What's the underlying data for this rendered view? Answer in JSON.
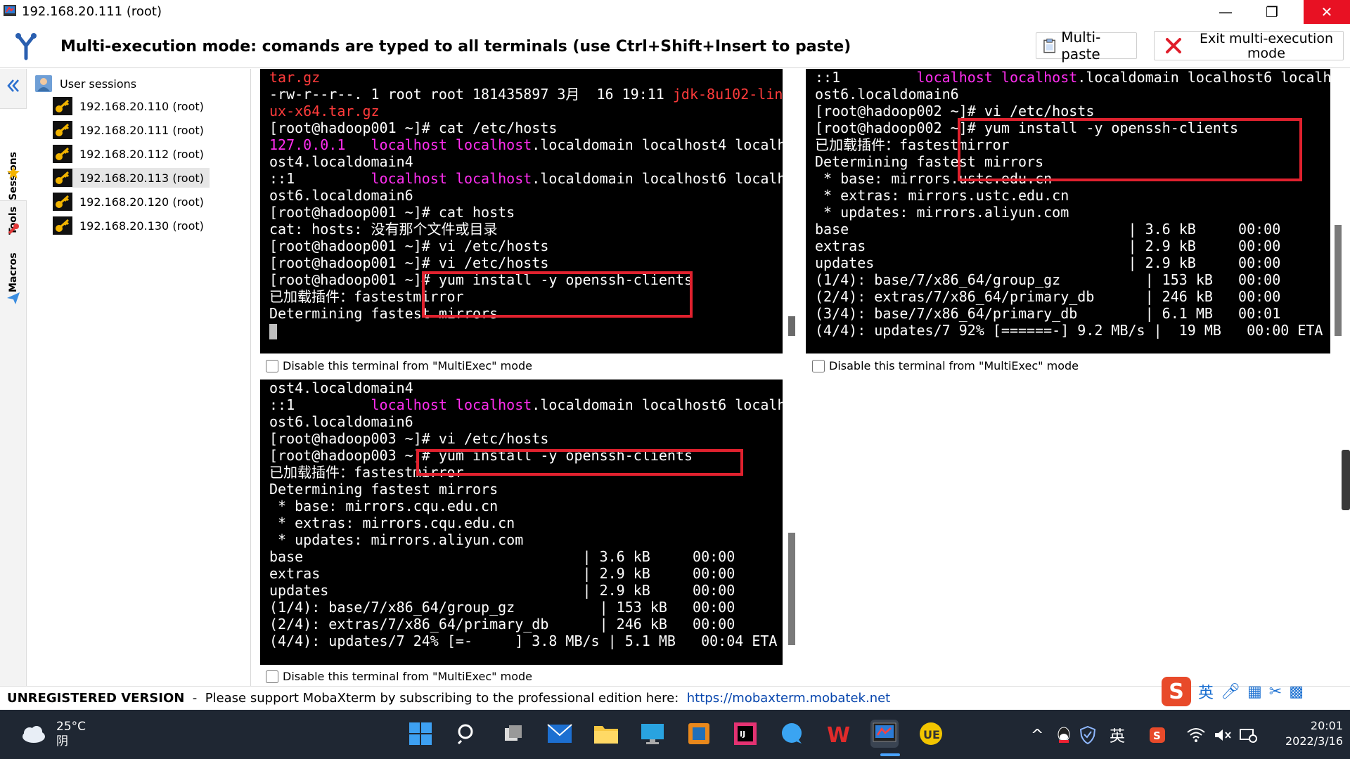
{
  "window": {
    "title": "192.168.20.111 (root)",
    "minimize": "—",
    "maximize": "❐",
    "close": "✕"
  },
  "toolbar": {
    "mode_text": "Multi-execution mode: comands are typed to all terminals (use Ctrl+Shift+Insert to paste)",
    "multipaste_label": "Multi-paste",
    "exit_label": "Exit multi-execution mode"
  },
  "sidebar": {
    "tabs": [
      "Sessions",
      "Tools",
      "Macros"
    ]
  },
  "sessions": {
    "root_label": "User sessions",
    "items": [
      {
        "label": "192.168.20.110 (root)"
      },
      {
        "label": "192.168.20.111 (root)"
      },
      {
        "label": "192.168.20.112 (root)"
      },
      {
        "label": "192.168.20.113 (root)"
      },
      {
        "label": "192.168.20.120 (root)"
      },
      {
        "label": "192.168.20.130 (root)"
      }
    ],
    "selected_index": 3
  },
  "terminals": [
    {
      "name": "hadoop001",
      "lines": [
        [
          {
            "t": "tar.gz",
            "c": "rd"
          }
        ],
        [
          {
            "t": "-rw-r--r--. 1 root root 181435897 3月  16 19:11 "
          },
          {
            "t": "jdk-8u102-lin",
            "c": "rd"
          }
        ],
        [
          {
            "t": "ux-x64.tar.gz",
            "c": "rd"
          }
        ],
        [
          {
            "t": "[root@hadoop001 ~]# cat /etc/hosts"
          }
        ],
        [
          {
            "t": "127.0.0.1   ",
            "c": "mg"
          },
          {
            "t": "localhost localhost",
            "c": "mg"
          },
          {
            "t": ".localdomain localhost4 localh"
          }
        ],
        [
          {
            "t": "ost4.localdomain4"
          }
        ],
        [
          {
            "t": "::1         "
          },
          {
            "t": "localhost localhost",
            "c": "mg"
          },
          {
            "t": ".localdomain localhost6 localh"
          }
        ],
        [
          {
            "t": "ost6.localdomain6"
          }
        ],
        [
          {
            "t": "[root@hadoop001 ~]# cat hosts"
          }
        ],
        [
          {
            "t": "cat: hosts: 没有那个文件或目录"
          }
        ],
        [
          {
            "t": "[root@hadoop001 ~]# vi /etc/hosts"
          }
        ],
        [
          {
            "t": "[root@hadoop001 ~]# vi /etc/hosts"
          }
        ],
        [
          {
            "t": "[root@hadoop001 ~]# yum install -y openssh-clients"
          }
        ],
        [
          {
            "t": "已加载插件：fastestmirror"
          }
        ],
        [
          {
            "t": "Determining fastest mirrors"
          }
        ]
      ],
      "checkbox_label": "Disable this terminal from \"MultiExec\" mode"
    },
    {
      "name": "hadoop002",
      "lines": [
        [
          {
            "t": "::1         "
          },
          {
            "t": "localhost localhost",
            "c": "mg"
          },
          {
            "t": ".localdomain localhost6 localh"
          }
        ],
        [
          {
            "t": "ost6.localdomain6"
          }
        ],
        [
          {
            "t": "[root@hadoop002 ~]# vi /etc/hosts"
          }
        ],
        [
          {
            "t": "[root@hadoop002 ~]# yum install -y openssh-clients"
          }
        ],
        [
          {
            "t": "已加载插件：fastestmirror"
          }
        ],
        [
          {
            "t": "Determining fastest mirrors"
          }
        ],
        [
          {
            "t": " * base: mirrors.ustc.edu.cn"
          }
        ],
        [
          {
            "t": " * extras: mirrors.ustc.edu.cn"
          }
        ],
        [
          {
            "t": " * updates: mirrors.aliyun.com"
          }
        ],
        [
          {
            "t": "base                                 | 3.6 kB     00:00"
          }
        ],
        [
          {
            "t": "extras                               | 2.9 kB     00:00"
          }
        ],
        [
          {
            "t": "updates                              | 2.9 kB     00:00"
          }
        ],
        [
          {
            "t": "(1/4): base/7/x86_64/group_gz          | 153 kB   00:00"
          }
        ],
        [
          {
            "t": "(2/4): extras/7/x86_64/primary_db      | 246 kB   00:00"
          }
        ],
        [
          {
            "t": "(3/4): base/7/x86_64/primary_db        | 6.1 MB   00:01"
          }
        ],
        [
          {
            "t": "(4/4): updates/7 92% [======-] 9.2 MB/s |  19 MB   00:00 ETA"
          }
        ]
      ],
      "checkbox_label": "Disable this terminal from \"MultiExec\" mode"
    },
    {
      "name": "hadoop003",
      "lines": [
        [
          {
            "t": "ost4.localdomain4"
          }
        ],
        [
          {
            "t": "::1         "
          },
          {
            "t": "localhost localhost",
            "c": "mg"
          },
          {
            "t": ".localdomain localhost6 localh"
          }
        ],
        [
          {
            "t": "ost6.localdomain6"
          }
        ],
        [
          {
            "t": "[root@hadoop003 ~]# vi /etc/hosts"
          }
        ],
        [
          {
            "t": "[root@hadoop003 ~]# yum install -y openssh-clients"
          }
        ],
        [
          {
            "t": "已加载插件：fastestmirror"
          }
        ],
        [
          {
            "t": "Determining fastest mirrors"
          }
        ],
        [
          {
            "t": " * base: mirrors.cqu.edu.cn"
          }
        ],
        [
          {
            "t": " * extras: mirrors.cqu.edu.cn"
          }
        ],
        [
          {
            "t": " * updates: mirrors.aliyun.com"
          }
        ],
        [
          {
            "t": "base                                 | 3.6 kB     00:00"
          }
        ],
        [
          {
            "t": "extras                               | 2.9 kB     00:00"
          }
        ],
        [
          {
            "t": "updates                              | 2.9 kB     00:00"
          }
        ],
        [
          {
            "t": "(1/4): base/7/x86_64/group_gz          | 153 kB   00:00"
          }
        ],
        [
          {
            "t": "(2/4): extras/7/x86_64/primary_db      | 246 kB   00:00"
          }
        ],
        [
          {
            "t": "(4/4): updates/7 24% [=-     ] 3.8 MB/s | 5.1 MB   00:04 ETA"
          }
        ]
      ],
      "checkbox_label": "Disable this terminal from \"MultiExec\" mode"
    }
  ],
  "status": {
    "unregistered": "UNREGISTERED VERSION",
    "separator": "  -  ",
    "message": "Please support MobaXterm by subscribing to the professional edition here:  ",
    "link": "https://mobaxterm.mobatek.net"
  },
  "ime": {
    "logo": "S",
    "lang": "英",
    "icons": [
      "mic-icon",
      "table-icon",
      "scissors-icon",
      "grid-icon"
    ]
  },
  "taskbar": {
    "temperature": "25°C",
    "weather": "阴",
    "tray_lang": "英",
    "time": "20:01",
    "date": "2022/3/16",
    "colors": {
      "bg": "#1f2733",
      "accent": "#0078d4"
    }
  },
  "colors": {
    "terminal_bg": "#000000",
    "magenta": "#ff2ef0",
    "red_text": "#ff3b3b",
    "highlight_box": "#e0212e"
  }
}
